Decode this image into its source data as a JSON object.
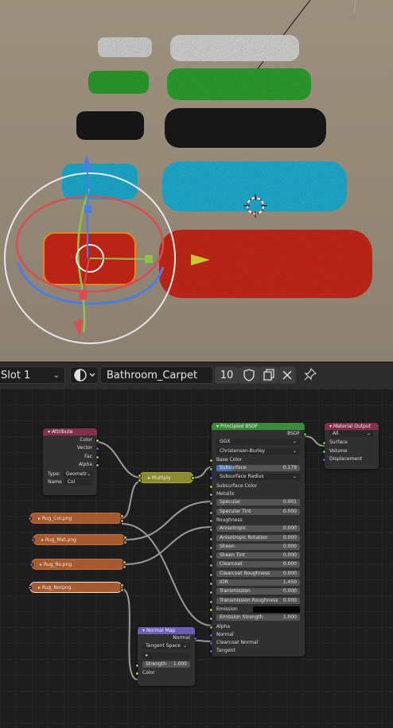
{
  "header": {
    "slot_label": "Slot 1",
    "material_name": "Bathroom_Carpet",
    "user_count": "10",
    "icons": [
      "chevron-down-icon",
      "material-sphere-icon",
      "fake-user-shield-icon",
      "duplicate-icon",
      "unlink-x-icon",
      "pin-icon"
    ]
  },
  "nodes": {
    "attribute": {
      "title": "Attribute",
      "outputs": [
        "Color",
        "Vector",
        "Fac",
        "Alpha"
      ],
      "type_label": "Type:",
      "type_value": "Geometr",
      "name_label": "Name",
      "name_value": "Col"
    },
    "multiply": {
      "title": "Multiply"
    },
    "textures": [
      "Rug_Col.png",
      "Rug_Met.png",
      "Rug_Ro.png",
      "Rug_Norpng"
    ],
    "normal_map": {
      "title": "Normal Map",
      "output": "Normal",
      "space": "Tangent Space",
      "strength_label": "Strength",
      "strength_value": "1.000",
      "input": "Color"
    },
    "bsdf": {
      "title": "Principled BSDF",
      "output": "BSDF",
      "distribution": "GGX",
      "subsurface_method": "Christensen-Burley",
      "base_color": "Base Color",
      "subsurface": {
        "label": "Subsurface",
        "value": "0.179",
        "fill": 0.179
      },
      "subsurface_radius": "Subsurface Radius",
      "subsurface_color": "Subsurface Color",
      "metallic": "Metallic",
      "specular": {
        "label": "Specular",
        "value": "0.001"
      },
      "specular_tint": {
        "label": "Specular Tint",
        "value": "0.000"
      },
      "roughness": "Roughness",
      "anisotropic": {
        "label": "Anisotropic",
        "value": "0.000"
      },
      "anisotropic_rotation": {
        "label": "Anisotropic Rotation",
        "value": "0.000"
      },
      "sheen": {
        "label": "Sheen",
        "value": "0.000"
      },
      "sheen_tint": {
        "label": "Sheen Tint",
        "value": "0.000"
      },
      "clearcoat": {
        "label": "Clearcoat",
        "value": "0.000"
      },
      "clearcoat_roughness": {
        "label": "Clearcoat Roughness",
        "value": "0.000"
      },
      "ior": {
        "label": "IOR",
        "value": "1.450"
      },
      "transmission": {
        "label": "Transmission",
        "value": "0.000"
      },
      "transmission_roughness": {
        "label": "Transmission Roughness",
        "value": "0.000"
      },
      "emission": "Emission",
      "emission_strength": {
        "label": "Emission Strength",
        "value": "1.000"
      },
      "alpha": "Alpha",
      "normal": "Normal",
      "clearcoat_normal": "Clearcoat Normal",
      "tangent": "Tangent"
    },
    "material_output": {
      "title": "Material Output",
      "target": "All",
      "inputs": [
        "Surface",
        "Volume",
        "Displacement"
      ]
    }
  },
  "colors": {
    "attribute_header": "#83314a",
    "shader_header": "#3c8a3c",
    "converter_header": "#6a5fb5",
    "output_header": "#83314a",
    "texture_node": "#a55a2f",
    "multiply_node": "#8a8a2e"
  }
}
